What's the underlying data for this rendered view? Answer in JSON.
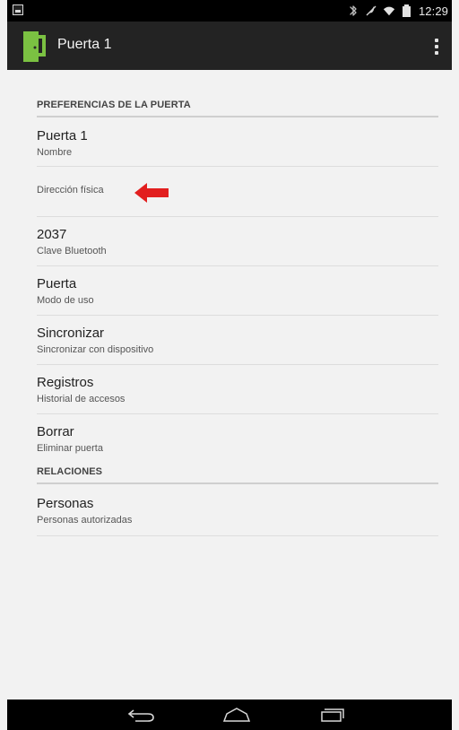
{
  "status_bar": {
    "time": "12:29",
    "icons": [
      "image-icon",
      "bluetooth-icon",
      "mute-icon",
      "wifi-icon",
      "battery-icon"
    ]
  },
  "app_bar": {
    "title": "Puerta 1",
    "logo_icon": "door-icon",
    "menu_icon": "overflow-menu-icon",
    "logo_color": "#7bc142"
  },
  "sections": {
    "door_preferences": {
      "header": "PREFERENCIAS DE LA PUERTA",
      "items": [
        {
          "title": "Puerta 1",
          "summary": "Nombre"
        },
        {
          "title": "",
          "summary": "Dirección física"
        },
        {
          "title": "2037",
          "summary": "Clave Bluetooth"
        },
        {
          "title": "Puerta",
          "summary": "Modo de uso"
        },
        {
          "title": "Sincronizar",
          "summary": "Sincronizar con dispositivo"
        },
        {
          "title": "Registros",
          "summary": "Historial de accesos"
        },
        {
          "title": "Borrar",
          "summary": "Eliminar puerta"
        }
      ]
    },
    "relations": {
      "header": "RELACIONES",
      "items": [
        {
          "title": "Personas",
          "summary": "Personas autorizadas"
        }
      ]
    }
  },
  "annotation": {
    "icon": "red-arrow-icon",
    "color": "#e21f1f"
  },
  "navigation_bar": {
    "buttons": [
      "back-icon",
      "home-icon",
      "recents-icon"
    ]
  }
}
